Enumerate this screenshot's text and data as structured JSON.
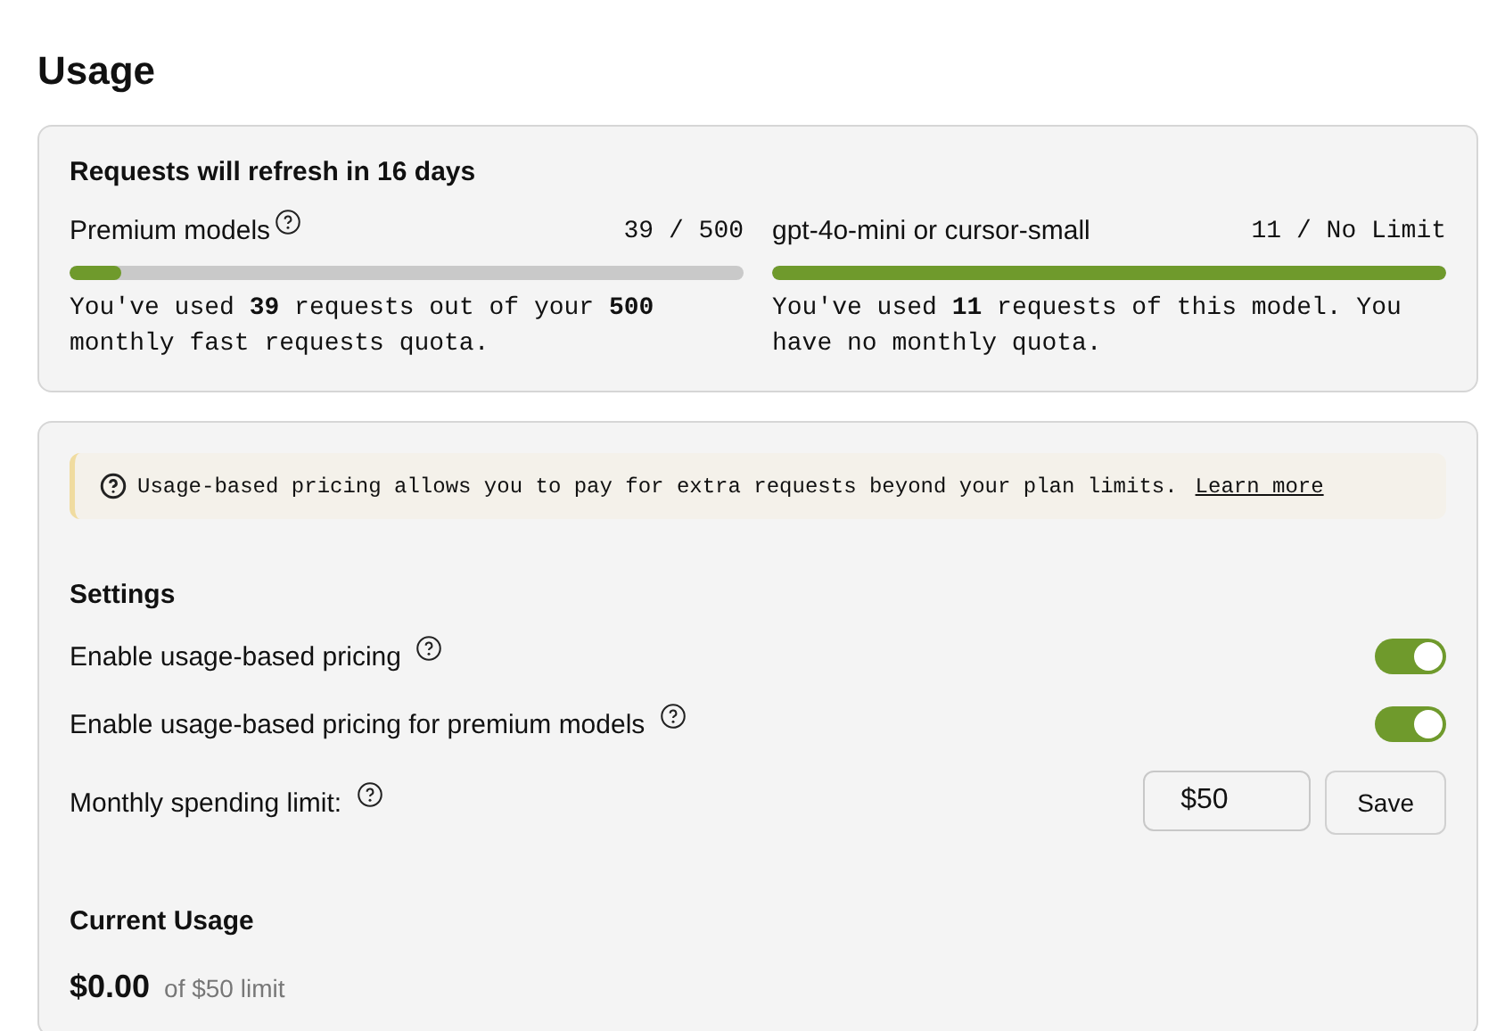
{
  "page": {
    "title": "Usage"
  },
  "quota": {
    "heading": "Requests will refresh in 16 days",
    "meters": [
      {
        "name": "Premium models",
        "help": true,
        "reading": "39 / 500",
        "level": 0.078,
        "note": "You've used **39** requests out of your **500** monthly fast requests quota."
      },
      {
        "name": "gpt-4o-mini or cursor-small",
        "help": false,
        "reading": "11 / No Limit",
        "level": 1,
        "note": "You've used **11** requests of this model. You have no monthly quota."
      }
    ]
  },
  "notice": {
    "text": "Usage-based pricing allows you to pay for extra requests beyond your plan limits.",
    "link": "Learn more"
  },
  "settings": {
    "heading": "Settings",
    "rows": [
      {
        "kind": "toggle",
        "label": "Enable usage-based pricing",
        "on": true
      },
      {
        "kind": "toggle",
        "label": "Enable usage-based pricing for premium models",
        "on": true
      },
      {
        "kind": "limit",
        "label": "Monthly spending limit:",
        "value": "$50",
        "button": "Save"
      }
    ]
  },
  "current_usage": {
    "heading": "Current Usage",
    "amount": "$0.00",
    "limit": "of $50 limit"
  }
}
